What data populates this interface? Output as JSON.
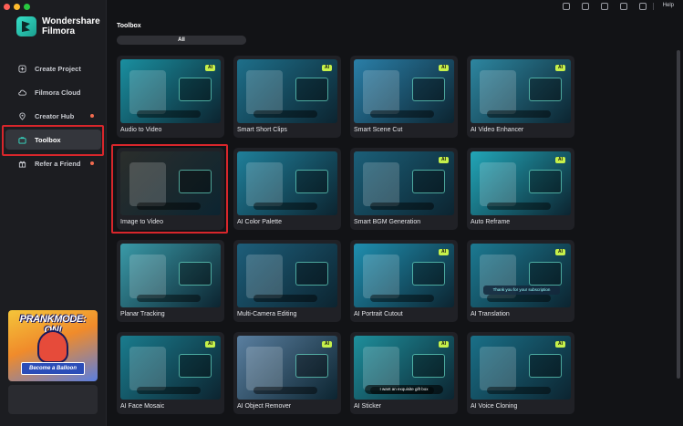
{
  "brand": {
    "line1": "Wondershare",
    "line2": "Filmora"
  },
  "sidebar": {
    "items": [
      {
        "label": "Create Project",
        "icon": "plus-square-icon",
        "active": false,
        "dot": false
      },
      {
        "label": "Filmora Cloud",
        "icon": "cloud-icon",
        "active": false,
        "dot": false
      },
      {
        "label": "Creator Hub",
        "icon": "location-pin-icon",
        "active": false,
        "dot": true
      },
      {
        "label": "Toolbox",
        "icon": "toolbox-icon",
        "active": true,
        "dot": false
      },
      {
        "label": "Refer a Friend",
        "icon": "gift-icon",
        "active": false,
        "dot": true
      }
    ],
    "promo": {
      "title": "PRANKMODE: ON!",
      "ribbon": "Become a Balloon"
    }
  },
  "topbar": {
    "help": "Help"
  },
  "main": {
    "title": "Toolbox",
    "tabs": [
      {
        "label": "All",
        "selected": true
      }
    ]
  },
  "cards": [
    {
      "label": "Audio to Video",
      "ai": "AI",
      "bg": "#1a8fa0"
    },
    {
      "label": "Smart Short Clips",
      "ai": "AI",
      "bg": "#1e6f8a"
    },
    {
      "label": "Smart Scene Cut",
      "ai": "AI",
      "bg": "#2a7fa8"
    },
    {
      "label": "AI Video Enhancer",
      "ai": "AI",
      "bg": "#2d86a0"
    },
    {
      "label": "Image to Video",
      "ai": "",
      "bg": "#2b2e2c"
    },
    {
      "label": "AI Color Palette",
      "ai": "",
      "bg": "#1f7f9a"
    },
    {
      "label": "Smart BGM Generation",
      "ai": "AI",
      "bg": "#1b5f78"
    },
    {
      "label": "Auto Reframe",
      "ai": "AI",
      "bg": "#22a6b8"
    },
    {
      "label": "Planar Tracking",
      "ai": "",
      "bg": "#3a9aa8"
    },
    {
      "label": "Multi-Camera Editing",
      "ai": "",
      "bg": "#1d5e7a"
    },
    {
      "label": "AI Portrait Cutout",
      "ai": "AI",
      "bg": "#1f8fb0"
    },
    {
      "label": "AI Translation",
      "ai": "AI",
      "bg": "#1c7a92"
    },
    {
      "label": "AI Face Mosaic",
      "ai": "AI",
      "bg": "#1a7c8e"
    },
    {
      "label": "AI Object Remover",
      "ai": "AI",
      "bg": "#5a7fa0"
    },
    {
      "label": "AI Sticker",
      "ai": "AI",
      "bg": "#1e8f9c"
    },
    {
      "label": "AI Voice Cloning",
      "ai": "AI",
      "bg": "#1a7088"
    }
  ],
  "card_overlay_texts": {
    "sticker_caption": "I want an exquisite gift box",
    "translation_caption": "Thank you for your subscription"
  }
}
